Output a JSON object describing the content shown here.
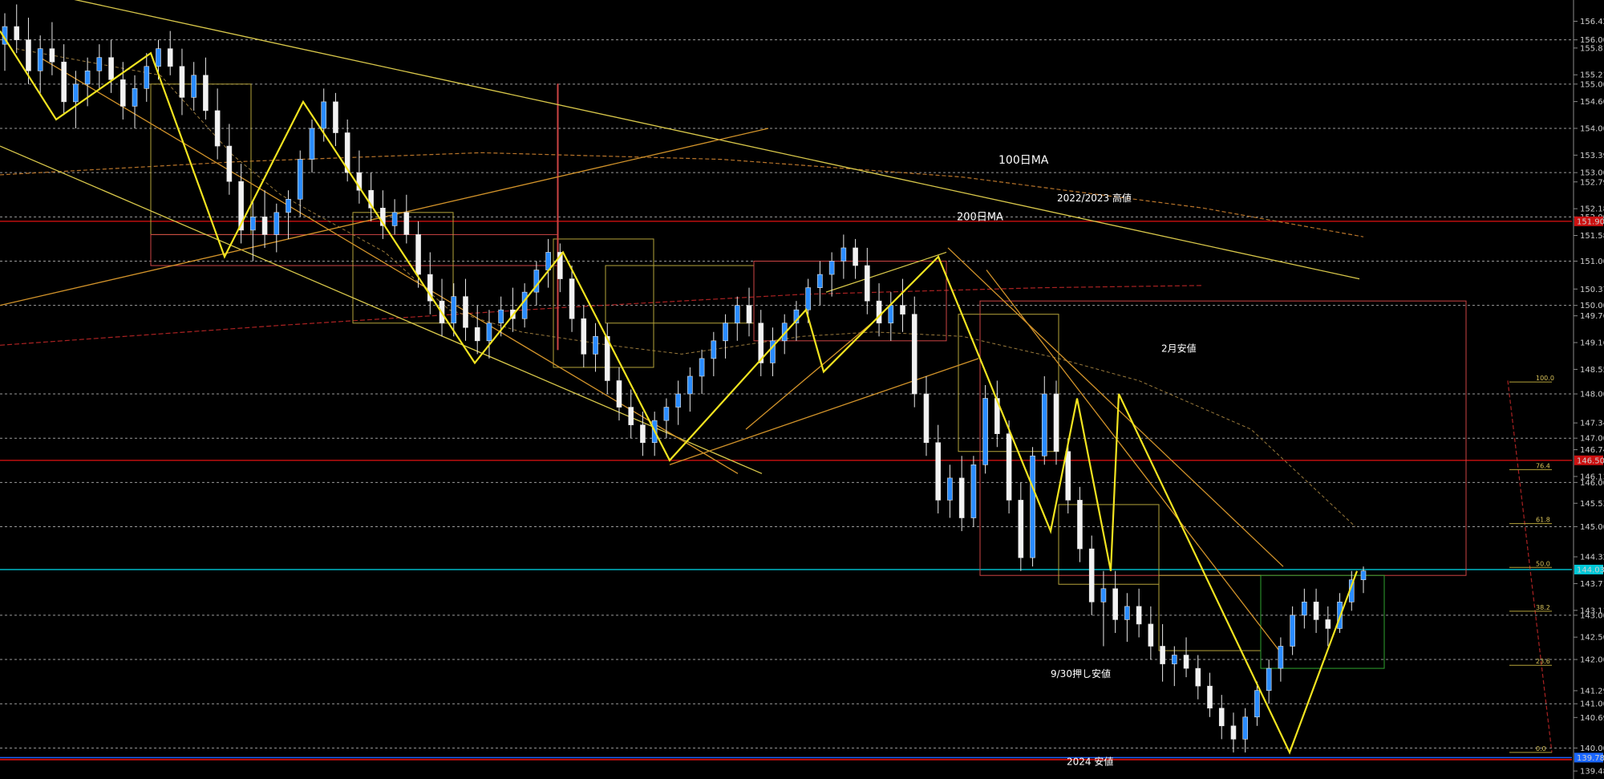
{
  "chart_data": {
    "type": "candlestick",
    "title": "",
    "xlabel": "",
    "ylabel": "",
    "ylim": [
      139.3,
      156.9
    ],
    "grid": true,
    "price_labels": [
      "156.420",
      "156.000",
      "155.815",
      "155.210",
      "155.000",
      "154.605",
      "154.000",
      "153.395",
      "153.000",
      "152.790",
      "152.185",
      "152.000",
      "151.580",
      "151.000",
      "150.370",
      "150.000",
      "149.765",
      "149.160",
      "148.555",
      "148.000",
      "147.345",
      "147.000",
      "146.740",
      "146.135",
      "146.000",
      "145.530",
      "145.000",
      "144.320",
      "143.715",
      "143.000",
      "143.110",
      "142.505",
      "142.000",
      "141.295",
      "141.000",
      "140.690",
      "140.000",
      "139.480"
    ],
    "marked_prices": [
      {
        "label": "151.900",
        "value": 151.9,
        "color": "#cc1111"
      },
      {
        "label": "146.500",
        "value": 146.5,
        "color": "#cc1111"
      },
      {
        "label": "144.032",
        "value": 144.032,
        "color": "#00c8d8"
      },
      {
        "label": "139.783",
        "value": 139.783,
        "color": "#1a66ff"
      }
    ],
    "annotations": [
      "100日MA",
      "200日MA",
      "2022/2023 高値",
      "2月安値",
      "9/30押し安値",
      "2024 安値"
    ],
    "fib_levels": [
      {
        "label": "100.0",
        "value": 148.27
      },
      {
        "label": "76.4",
        "value": 146.29
      },
      {
        "label": "61.8",
        "value": 145.07
      },
      {
        "label": "50.0",
        "value": 144.08
      },
      {
        "label": "38.2",
        "value": 143.09
      },
      {
        "label": "23.6",
        "value": 141.87
      },
      {
        "label": "0.0",
        "value": 139.9
      }
    ],
    "candles": [
      [
        155.9,
        156.6,
        155.3,
        156.3
      ],
      [
        156.3,
        156.8,
        155.7,
        156.0
      ],
      [
        156.0,
        156.5,
        155.0,
        155.3
      ],
      [
        155.3,
        156.1,
        154.8,
        155.8
      ],
      [
        155.8,
        156.4,
        155.2,
        155.5
      ],
      [
        155.5,
        155.9,
        154.3,
        154.6
      ],
      [
        154.6,
        155.3,
        154.0,
        155.0
      ],
      [
        155.0,
        155.6,
        154.5,
        155.3
      ],
      [
        155.3,
        155.9,
        154.9,
        155.6
      ],
      [
        155.6,
        156.0,
        154.8,
        155.1
      ],
      [
        155.1,
        155.5,
        154.2,
        154.5
      ],
      [
        154.5,
        155.2,
        154.0,
        154.9
      ],
      [
        154.9,
        155.7,
        154.6,
        155.4
      ],
      [
        155.4,
        156.0,
        155.1,
        155.8
      ],
      [
        155.8,
        156.2,
        155.2,
        155.4
      ],
      [
        155.4,
        155.8,
        154.3,
        154.7
      ],
      [
        154.7,
        155.5,
        154.4,
        155.2
      ],
      [
        155.2,
        155.6,
        154.2,
        154.4
      ],
      [
        154.4,
        154.9,
        153.3,
        153.6
      ],
      [
        153.6,
        154.1,
        152.5,
        152.8
      ],
      [
        152.8,
        153.2,
        151.4,
        151.7
      ],
      [
        151.7,
        152.4,
        151.0,
        152.0
      ],
      [
        152.0,
        152.6,
        151.3,
        151.6
      ],
      [
        151.6,
        152.3,
        151.2,
        152.1
      ],
      [
        152.1,
        152.6,
        151.5,
        152.4
      ],
      [
        152.4,
        153.5,
        152.0,
        153.3
      ],
      [
        153.3,
        154.2,
        153.0,
        154.0
      ],
      [
        154.0,
        154.9,
        153.7,
        154.6
      ],
      [
        154.6,
        154.8,
        153.6,
        153.9
      ],
      [
        153.9,
        154.2,
        152.8,
        153.0
      ],
      [
        153.0,
        153.5,
        152.3,
        152.6
      ],
      [
        152.6,
        153.0,
        151.9,
        152.2
      ],
      [
        152.2,
        152.6,
        151.5,
        151.8
      ],
      [
        151.8,
        152.4,
        151.6,
        152.1
      ],
      [
        152.1,
        152.5,
        151.4,
        151.6
      ],
      [
        151.6,
        151.9,
        150.4,
        150.7
      ],
      [
        150.7,
        151.2,
        149.8,
        150.1
      ],
      [
        150.1,
        150.6,
        149.3,
        149.6
      ],
      [
        149.6,
        150.5,
        149.3,
        150.2
      ],
      [
        150.2,
        150.6,
        149.2,
        149.5
      ],
      [
        149.5,
        150.0,
        148.9,
        149.2
      ],
      [
        149.2,
        149.9,
        148.8,
        149.6
      ],
      [
        149.6,
        150.2,
        149.3,
        149.9
      ],
      [
        149.9,
        150.4,
        149.4,
        149.7
      ],
      [
        149.7,
        150.5,
        149.5,
        150.3
      ],
      [
        150.3,
        151.0,
        150.0,
        150.8
      ],
      [
        150.8,
        151.5,
        150.4,
        151.2
      ],
      [
        151.2,
        151.4,
        150.3,
        150.6
      ],
      [
        150.6,
        150.9,
        149.4,
        149.7
      ],
      [
        149.7,
        150.0,
        148.6,
        148.9
      ],
      [
        148.9,
        149.6,
        148.5,
        149.3
      ],
      [
        149.3,
        149.6,
        148.0,
        148.3
      ],
      [
        148.3,
        148.6,
        147.4,
        147.7
      ],
      [
        147.7,
        148.1,
        147.0,
        147.3
      ],
      [
        147.3,
        147.6,
        146.6,
        146.9
      ],
      [
        146.9,
        147.6,
        146.6,
        147.4
      ],
      [
        147.4,
        147.9,
        147.0,
        147.7
      ],
      [
        147.7,
        148.3,
        147.3,
        148.0
      ],
      [
        148.0,
        148.6,
        147.6,
        148.4
      ],
      [
        148.4,
        149.0,
        148.0,
        148.8
      ],
      [
        148.8,
        149.4,
        148.4,
        149.2
      ],
      [
        149.2,
        149.8,
        148.8,
        149.6
      ],
      [
        149.6,
        150.2,
        149.2,
        150.0
      ],
      [
        150.0,
        150.4,
        149.3,
        149.6
      ],
      [
        149.6,
        149.9,
        148.4,
        148.7
      ],
      [
        148.7,
        149.5,
        148.4,
        149.2
      ],
      [
        149.2,
        149.8,
        148.9,
        149.6
      ],
      [
        149.6,
        150.1,
        149.2,
        149.9
      ],
      [
        149.9,
        150.6,
        149.6,
        150.4
      ],
      [
        150.4,
        151.0,
        150.0,
        150.7
      ],
      [
        150.7,
        151.2,
        150.2,
        151.0
      ],
      [
        151.0,
        151.6,
        150.6,
        151.3
      ],
      [
        151.3,
        151.5,
        150.6,
        150.9
      ],
      [
        150.9,
        151.3,
        149.8,
        150.1
      ],
      [
        150.1,
        150.5,
        149.3,
        149.6
      ],
      [
        149.6,
        150.3,
        149.2,
        150.0
      ],
      [
        150.0,
        150.6,
        149.4,
        149.8
      ],
      [
        149.8,
        150.2,
        147.7,
        148.0
      ],
      [
        148.0,
        148.4,
        146.6,
        146.9
      ],
      [
        146.9,
        147.3,
        145.3,
        145.6
      ],
      [
        145.6,
        146.4,
        145.2,
        146.1
      ],
      [
        146.1,
        146.6,
        144.9,
        145.2
      ],
      [
        145.2,
        146.6,
        145.0,
        146.4
      ],
      [
        146.4,
        148.2,
        146.2,
        147.9
      ],
      [
        147.9,
        148.3,
        146.8,
        147.1
      ],
      [
        147.1,
        147.4,
        145.3,
        145.6
      ],
      [
        145.6,
        146.0,
        144.0,
        144.3
      ],
      [
        144.3,
        146.8,
        144.1,
        146.6
      ],
      [
        146.6,
        148.4,
        146.4,
        148.0
      ],
      [
        148.0,
        148.3,
        146.4,
        146.7
      ],
      [
        146.7,
        147.0,
        145.3,
        145.6
      ],
      [
        145.6,
        145.9,
        144.2,
        144.5
      ],
      [
        144.5,
        144.8,
        143.0,
        143.3
      ],
      [
        143.3,
        144.0,
        142.3,
        143.6
      ],
      [
        143.6,
        144.0,
        142.6,
        142.9
      ],
      [
        142.9,
        143.5,
        142.4,
        143.2
      ],
      [
        143.2,
        143.6,
        142.5,
        142.8
      ],
      [
        142.8,
        143.2,
        142.0,
        142.3
      ],
      [
        142.3,
        142.8,
        141.5,
        141.9
      ],
      [
        141.9,
        142.3,
        141.4,
        142.1
      ],
      [
        142.1,
        142.5,
        141.6,
        141.8
      ],
      [
        141.8,
        142.1,
        141.1,
        141.4
      ],
      [
        141.4,
        141.7,
        140.7,
        140.9
      ],
      [
        140.9,
        141.2,
        140.2,
        140.5
      ],
      [
        140.5,
        140.8,
        139.9,
        140.2
      ],
      [
        140.2,
        140.9,
        139.9,
        140.7
      ],
      [
        140.7,
        141.5,
        140.5,
        141.3
      ],
      [
        141.3,
        142.0,
        141.0,
        141.8
      ],
      [
        141.8,
        142.5,
        141.5,
        142.3
      ],
      [
        142.3,
        143.2,
        142.1,
        143.0
      ],
      [
        143.0,
        143.6,
        142.7,
        143.3
      ],
      [
        143.3,
        143.6,
        142.6,
        142.9
      ],
      [
        142.9,
        143.2,
        142.3,
        142.7
      ],
      [
        142.7,
        143.5,
        142.6,
        143.3
      ],
      [
        143.3,
        144.0,
        143.1,
        143.8
      ],
      [
        143.8,
        144.1,
        143.5,
        144.0
      ]
    ]
  }
}
